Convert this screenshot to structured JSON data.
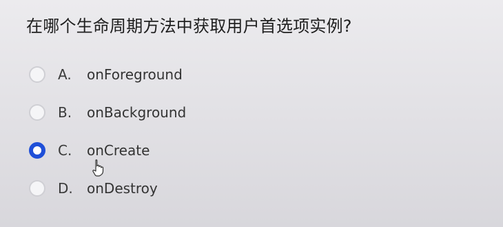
{
  "question": {
    "title": "在哪个生命周期方法中获取用户首选项实例?"
  },
  "options": [
    {
      "letter": "A.",
      "text": "onForeground",
      "selected": false
    },
    {
      "letter": "B.",
      "text": "onBackground",
      "selected": false
    },
    {
      "letter": "C.",
      "text": "onCreate",
      "selected": true
    },
    {
      "letter": "D.",
      "text": "onDestroy",
      "selected": false
    }
  ],
  "colors": {
    "selected_radio": "#1f4fd8",
    "unselected_radio": "#cfcfd4",
    "text": "#333333"
  },
  "icons": {
    "cursor": "hand-pointer-icon"
  }
}
